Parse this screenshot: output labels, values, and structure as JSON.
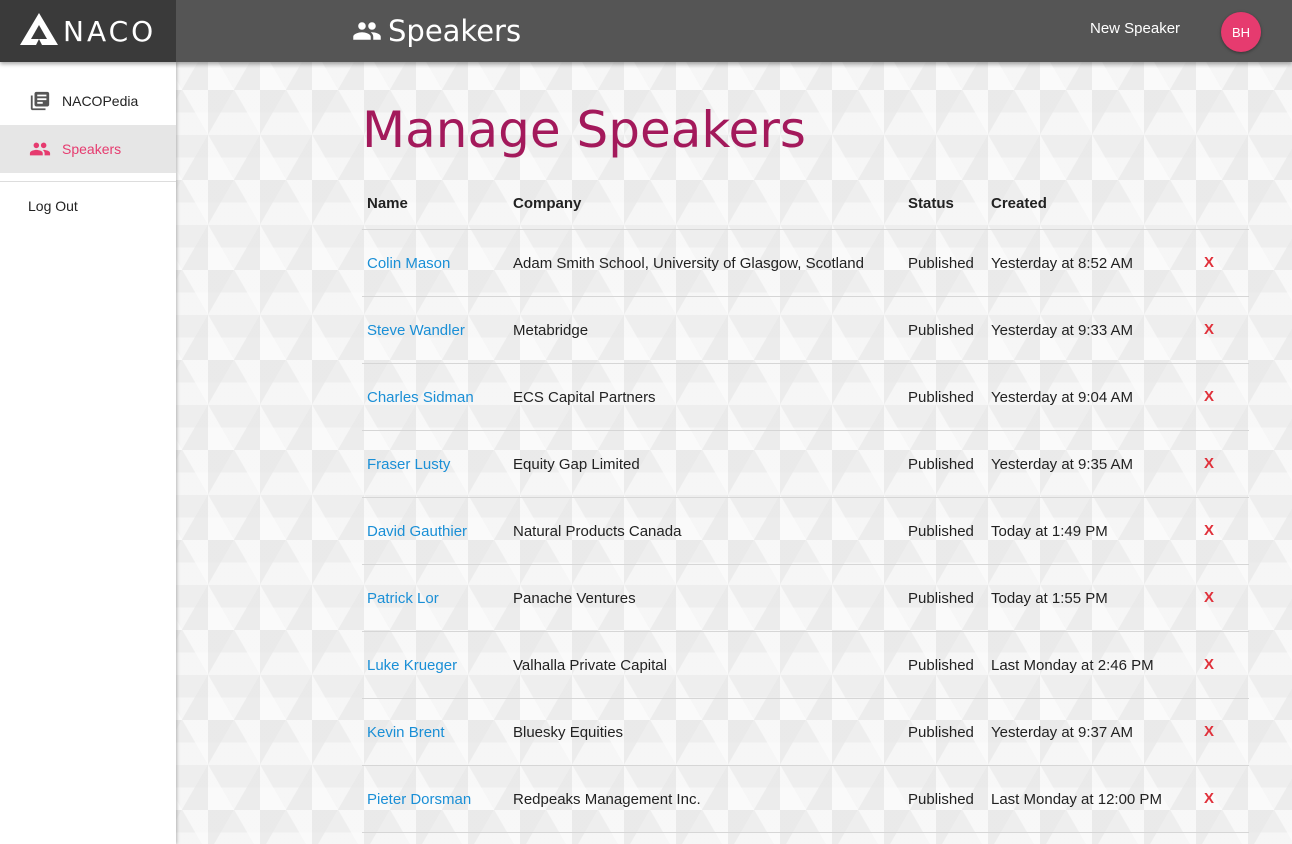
{
  "brand": {
    "logo_text": "NACO"
  },
  "header": {
    "title": "Speakers",
    "title_icon": "people-icon",
    "new_speaker_label": "New Speaker",
    "avatar_initials": "BH"
  },
  "sidebar": {
    "items": [
      {
        "label": "NACOPedia",
        "icon": "library-books-icon"
      },
      {
        "label": "Speakers",
        "icon": "people-icon",
        "active": true
      }
    ],
    "logout_label": "Log Out"
  },
  "main": {
    "title": "Manage Speakers",
    "columns": [
      "Name",
      "Company",
      "Status",
      "Created"
    ],
    "delete_label": "X",
    "rows": [
      {
        "name": "Colin Mason",
        "company": "Adam Smith School, University of Glasgow, Scotland",
        "status": "Published",
        "created": "Yesterday at 8:52 AM"
      },
      {
        "name": "Steve Wandler",
        "company": "Metabridge",
        "status": "Published",
        "created": "Yesterday at 9:33 AM"
      },
      {
        "name": "Charles Sidman",
        "company": "ECS Capital Partners",
        "status": "Published",
        "created": "Yesterday at 9:04 AM"
      },
      {
        "name": "Fraser Lusty",
        "company": "Equity Gap Limited",
        "status": "Published",
        "created": "Yesterday at 9:35 AM"
      },
      {
        "name": "David Gauthier",
        "company": "Natural Products Canada",
        "status": "Published",
        "created": "Today at 1:49 PM"
      },
      {
        "name": "Patrick Lor",
        "company": "Panache Ventures",
        "status": "Published",
        "created": "Today at 1:55 PM"
      },
      {
        "name": "Luke Krueger",
        "company": "Valhalla Private Capital",
        "status": "Published",
        "created": "Last Monday at 2:46 PM"
      },
      {
        "name": "Kevin Brent",
        "company": "Bluesky Equities",
        "status": "Published",
        "created": "Yesterday at 9:37 AM"
      },
      {
        "name": "Pieter Dorsman",
        "company": "Redpeaks Management Inc.",
        "status": "Published",
        "created": "Last Monday at 12:00 PM"
      }
    ]
  },
  "colors": {
    "accent": "#e63b6f",
    "title": "#a3195b",
    "link": "#1a8fd6",
    "delete": "#e0303a",
    "topbar": "#555555"
  }
}
